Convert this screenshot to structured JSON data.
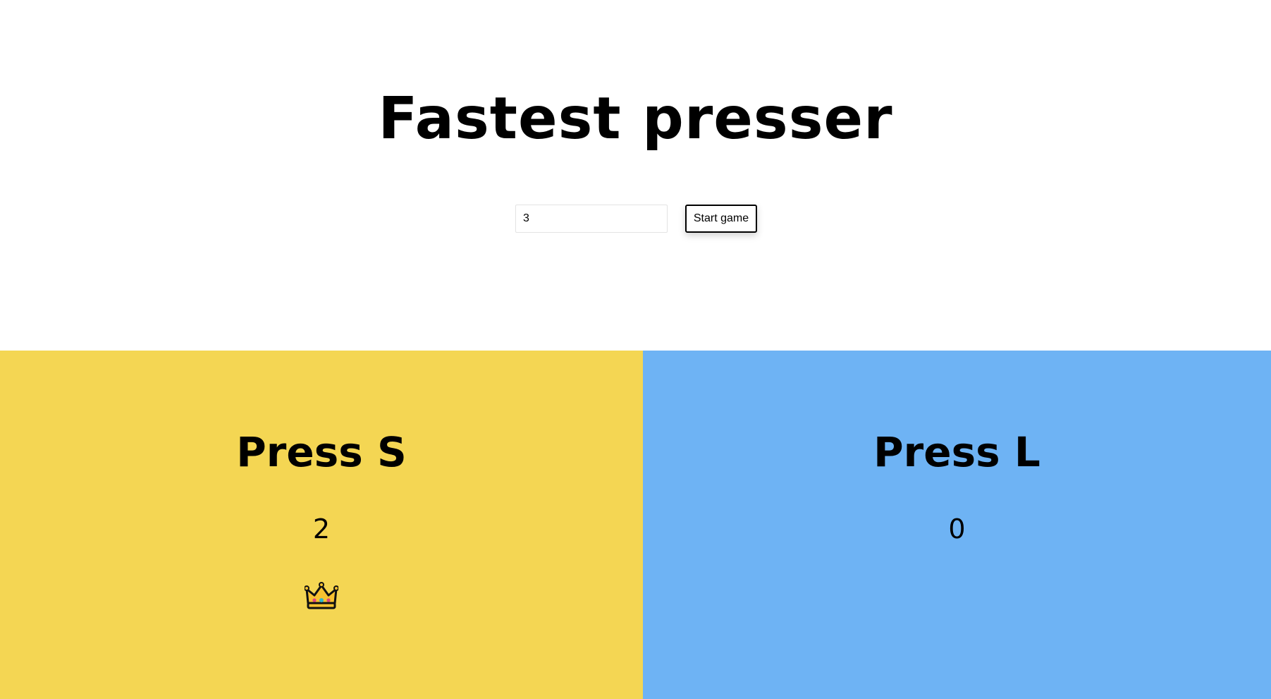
{
  "title": "Fastest presser",
  "controls": {
    "rounds_value": "3",
    "start_label": "Start game"
  },
  "players": [
    {
      "heading": "Press S",
      "score": "2",
      "color": "#f4d653",
      "winner": true,
      "winner_icon": "crown-icon"
    },
    {
      "heading": "Press L",
      "score": "0",
      "color": "#6eb3f4",
      "winner": false
    }
  ]
}
